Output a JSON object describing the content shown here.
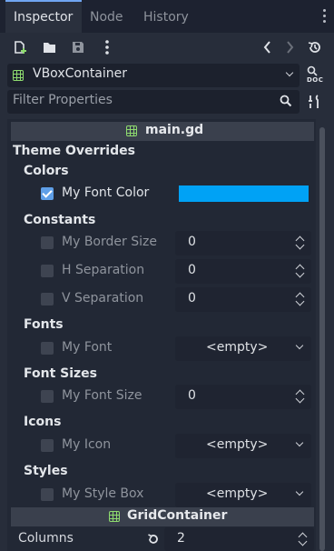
{
  "tabs": [
    {
      "label": "Inspector",
      "active": true
    },
    {
      "label": "Node",
      "active": false
    },
    {
      "label": "History",
      "active": false
    }
  ],
  "toolbar": {
    "icons": [
      "new-resource-icon",
      "open-folder-icon",
      "save-icon",
      "kebab-menu-icon",
      "back-arrow-icon",
      "forward-arrow-icon",
      "history-icon"
    ]
  },
  "node_selector": {
    "value": "VBoxContainer",
    "doc_label": "DOC"
  },
  "filter": {
    "placeholder": "Filter Properties"
  },
  "script_section": {
    "label": "main.gd"
  },
  "theme_overrides": {
    "label": "Theme Overrides",
    "categories": {
      "colors": {
        "label": "Colors"
      },
      "constants": {
        "label": "Constants"
      },
      "fonts": {
        "label": "Fonts"
      },
      "font_sizes": {
        "label": "Font Sizes"
      },
      "icons": {
        "label": "Icons"
      },
      "styles": {
        "label": "Styles"
      }
    },
    "props": {
      "font_color": {
        "label": "My Font Color",
        "checked": true,
        "color": "#00a2f5"
      },
      "border_size": {
        "label": "My Border Size",
        "value": "0"
      },
      "h_separation": {
        "label": "H Separation",
        "value": "0"
      },
      "v_separation": {
        "label": "V Separation",
        "value": "0"
      },
      "font": {
        "label": "My Font",
        "value": "<empty>"
      },
      "font_size": {
        "label": "My Font Size",
        "value": "0"
      },
      "icon": {
        "label": "My Icon",
        "value": "<empty>"
      },
      "style_box": {
        "label": "My Style Box",
        "value": "<empty>"
      }
    }
  },
  "grid_section": {
    "label": "GridContainer"
  },
  "columns": {
    "label": "Columns",
    "value": "2"
  },
  "colors": {
    "accent": "#70a6f2",
    "node_green": "#8edb6f",
    "checkbox_blue": "#5f9fe8"
  }
}
